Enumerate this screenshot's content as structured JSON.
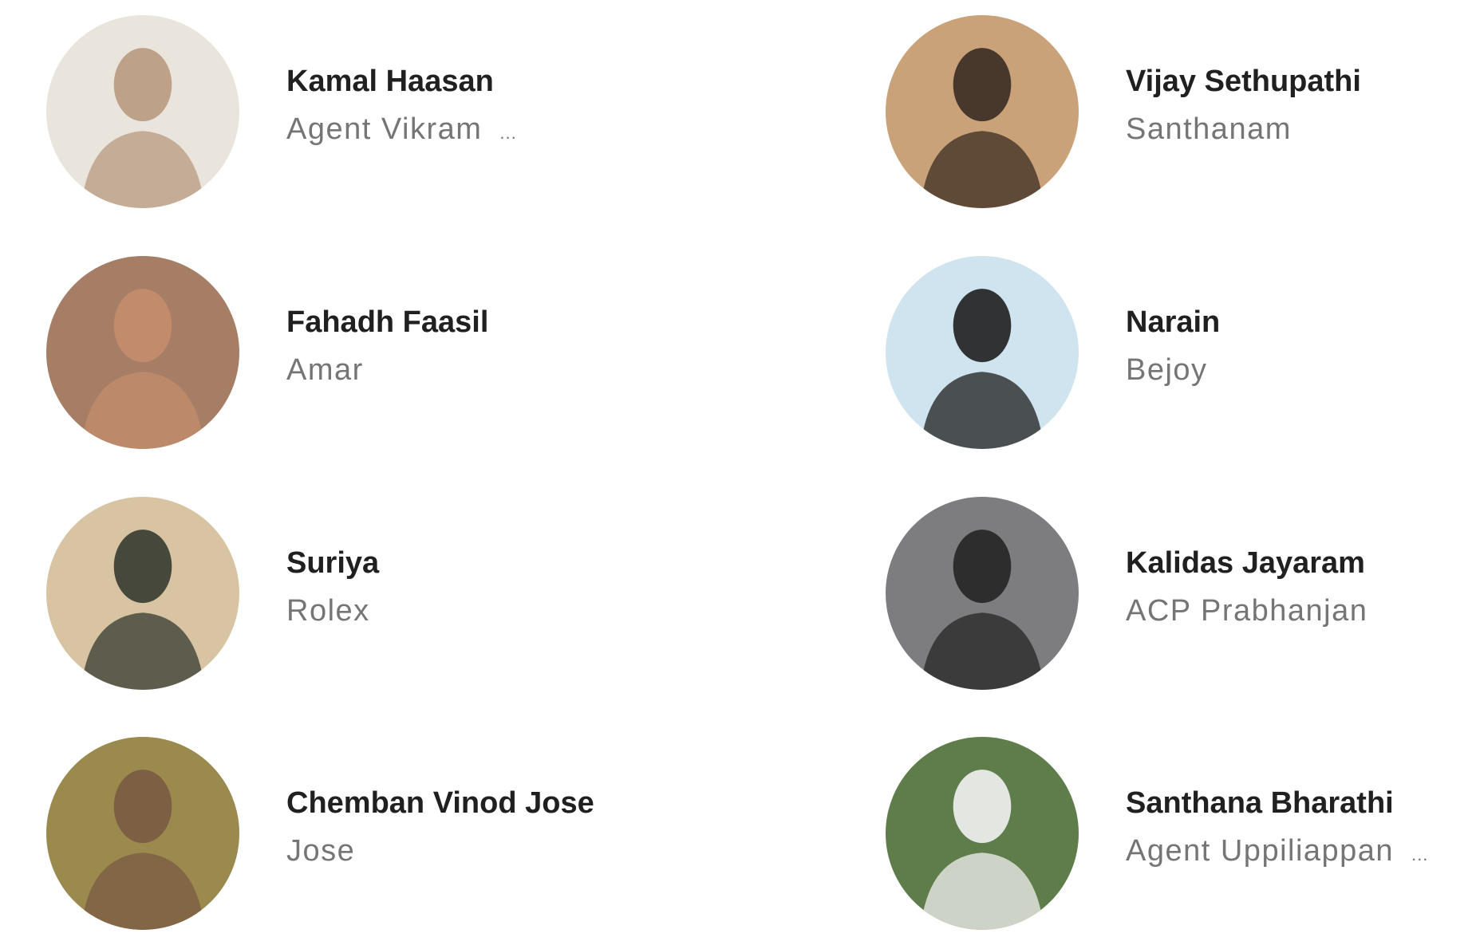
{
  "cast": [
    {
      "name": "Kamal Haasan",
      "role": "Agent Vikram",
      "truncated": true,
      "bg": "#e9e4dc",
      "fg": "#b89a80"
    },
    {
      "name": "Vijay Sethupathi",
      "role": "Santhanam",
      "truncated": false,
      "bg": "#c9a27a",
      "fg": "#3a2c22"
    },
    {
      "name": "Fahadh Faasil",
      "role": "Amar",
      "truncated": false,
      "bg": "#a67e66",
      "fg": "#c48d6d"
    },
    {
      "name": "Narain",
      "role": "Bejoy",
      "truncated": false,
      "bg": "#cfe4ee",
      "fg": "#1e1e1e"
    },
    {
      "name": "Suriya",
      "role": "Rolex",
      "truncated": false,
      "bg": "#d8c4a2",
      "fg": "#353b30"
    },
    {
      "name": "Kalidas Jayaram",
      "role": "ACP Prabhanjan",
      "truncated": false,
      "bg": "#7d7d80",
      "fg": "#252525"
    },
    {
      "name": "Chemban Vinod Jose",
      "role": "Jose",
      "truncated": false,
      "bg": "#9a8a4e",
      "fg": "#7a5a44"
    },
    {
      "name": "Santhana Bharathi",
      "role": "Agent Uppiliappan",
      "truncated": true,
      "bg": "#5f7d4a",
      "fg": "#f2f2f2"
    }
  ],
  "ellipsis": "..."
}
